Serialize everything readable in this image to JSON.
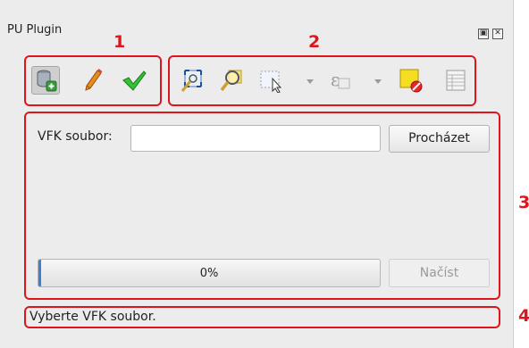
{
  "window": {
    "title": "PU Plugin"
  },
  "annotations": [
    "1",
    "2",
    "3",
    "4"
  ],
  "annotation_color": "#e0151b",
  "toolbar1": {
    "buttons": [
      {
        "icon": "database-add-icon",
        "active": true
      },
      {
        "icon": "pencil-icon",
        "active": false
      },
      {
        "icon": "checkmark-icon",
        "active": false
      }
    ]
  },
  "toolbar2": {
    "buttons": [
      {
        "icon": "zoom-full-icon"
      },
      {
        "icon": "zoom-selection-icon"
      },
      {
        "icon": "select-rectangle-icon"
      },
      {
        "icon": "expression-select-icon"
      },
      {
        "icon": "deselect-icon"
      },
      {
        "icon": "attribute-table-icon"
      }
    ]
  },
  "form": {
    "vfk_label": "VFK soubor:",
    "vfk_value": "",
    "browse_label": "Procházet",
    "load_label": "Načíst"
  },
  "progress": {
    "value": 0,
    "text": "0%"
  },
  "status": {
    "text": "Vyberte VFK soubor."
  }
}
